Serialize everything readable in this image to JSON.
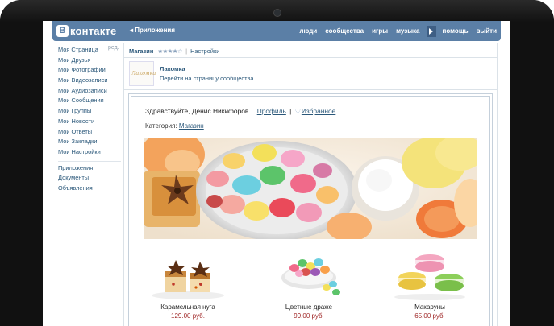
{
  "header": {
    "logo_letter": "В",
    "logo_text": "контакте",
    "apps_label": "Приложения",
    "nav": [
      "люди",
      "сообщества",
      "игры",
      "музыка"
    ],
    "nav_right": [
      "помощь",
      "выйти"
    ]
  },
  "left_menu": {
    "edit_label": "ред.",
    "items": [
      "Моя Страница",
      "Мои Друзья",
      "Мои Фотографии",
      "Мои Видеозаписи",
      "Мои Аудиозаписи",
      "Мои Сообщения",
      "Мои Группы",
      "Мои Новости",
      "Мои Ответы",
      "Мои Закладки",
      "Мои Настройки"
    ],
    "extra": [
      "Приложения",
      "Документы",
      "Объявления"
    ]
  },
  "breadcrumb": {
    "app_name": "Магазин",
    "rating_stars": "★★★★☆",
    "separator": "|",
    "settings": "Настройки"
  },
  "group": {
    "avatar_text": "Лакомка",
    "name": "Лакомка",
    "link": "Перейти на страницу сообщества"
  },
  "shop": {
    "greeting": "Здравствуйте, Денис Никифоров",
    "profile_link": "Профиль",
    "divider": "|",
    "favorites_link": "Избранное",
    "category_label": "Категория:",
    "category_value": "Магазин"
  },
  "products": [
    {
      "name": "Карамельная нуга",
      "price": "129.00 руб."
    },
    {
      "name": "Цветные драже",
      "price": "99.00 руб."
    },
    {
      "name": "Макаруны",
      "price": "65.00 руб."
    }
  ],
  "colors": {
    "vk_blue": "#5b7fa6",
    "link": "#2b587a",
    "price": "#a12a2a"
  }
}
